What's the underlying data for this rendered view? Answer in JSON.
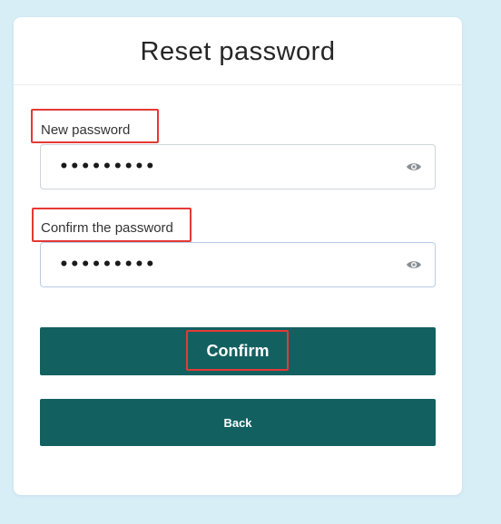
{
  "title": "Reset password",
  "new_password": {
    "label": "New password",
    "value": "•••••••••",
    "visibility_icon": "eye-icon"
  },
  "confirm_password": {
    "label": "Confirm the password",
    "value": "•••••••••",
    "visibility_icon": "eye-icon"
  },
  "buttons": {
    "confirm_label": "Confirm",
    "back_label": "Back"
  },
  "colors": {
    "background": "#d8eef7",
    "button": "#136061",
    "highlight": "#e53935"
  }
}
